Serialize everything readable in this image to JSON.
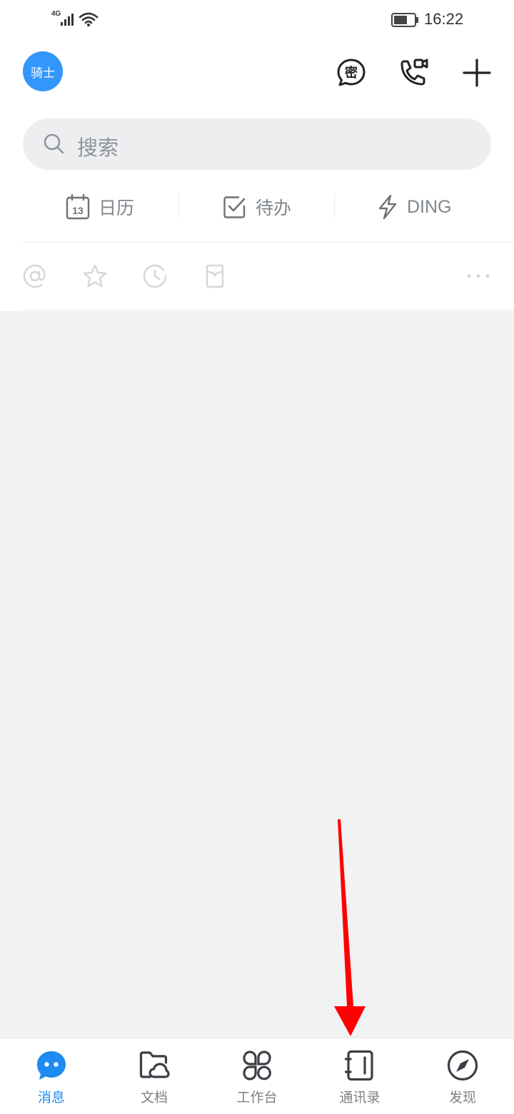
{
  "status_bar": {
    "network": "4G",
    "time": "16:22",
    "icons": [
      "signal-icon",
      "wifi-icon",
      "battery-icon"
    ]
  },
  "header": {
    "avatar_text": "骑士",
    "avatar_color": "#3296fa",
    "actions": [
      "secret-chat-icon",
      "video-call-icon",
      "add-icon"
    ],
    "secret_glyph": "密"
  },
  "search": {
    "placeholder": "搜索"
  },
  "quick_actions": [
    {
      "label": "日历",
      "icon": "calendar-icon",
      "badge": "13"
    },
    {
      "label": "待办",
      "icon": "todo-check-icon"
    },
    {
      "label": "DING",
      "icon": "lightning-icon"
    }
  ],
  "filters": [
    "at-mention-icon",
    "star-icon",
    "recent-clock-icon",
    "red-envelope-icon",
    "more-icon"
  ],
  "tabbar": {
    "active": "消息",
    "accent": "#1d8bf0",
    "items": [
      {
        "label": "消息",
        "icon": "message-bubble-icon"
      },
      {
        "label": "文档",
        "icon": "cloud-folder-icon"
      },
      {
        "label": "工作台",
        "icon": "workbench-grid-icon"
      },
      {
        "label": "通讯录",
        "icon": "contacts-book-icon"
      },
      {
        "label": "发现",
        "icon": "compass-icon"
      }
    ]
  },
  "annotation": {
    "arrow_color": "#ff0000"
  }
}
